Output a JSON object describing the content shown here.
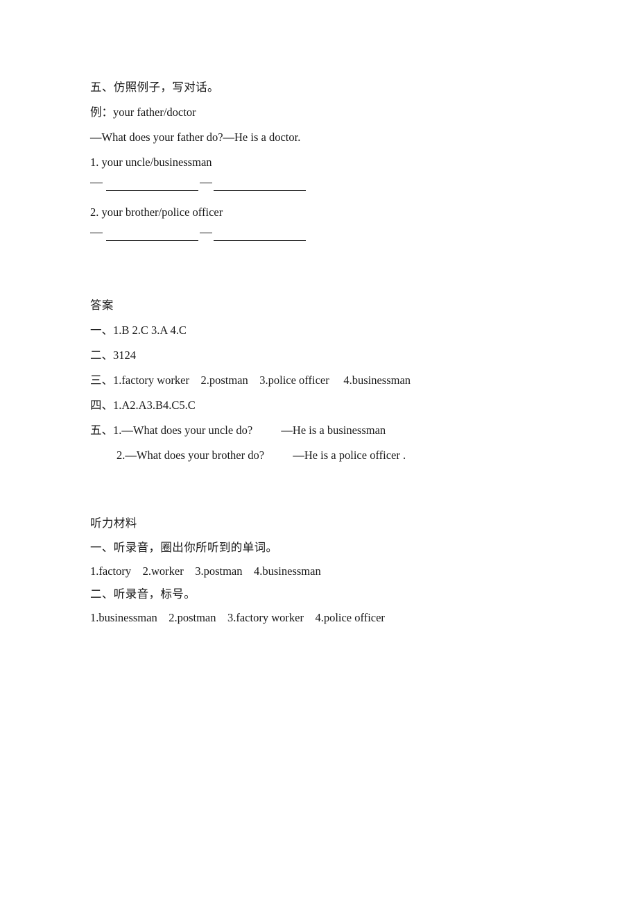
{
  "document": {
    "exercise_section": {
      "title": "五、仿照例子，写对话。",
      "example_label": "例：your father/doctor",
      "example_dialogue": "—What does your father do?—He is a doctor.",
      "items": [
        {
          "prompt": "1. your uncle/businessman"
        },
        {
          "prompt": "2. your brother/police officer"
        }
      ]
    },
    "answers_section": {
      "title": "答案",
      "rows": [
        "一、1.B 2.C 3.A 4.C",
        "二、3124",
        "三、1.factory worker    2.postman    3.police officer     4.businessman",
        "四、1.A2.A3.B4.C5.C"
      ],
      "row_five_label": "五、1.—What does your uncle do?          —He is a businessman",
      "row_five_second": "2.—What does your brother do?          —He is a police officer ."
    },
    "listening_section": {
      "title": "听力材料",
      "part_one_title": "一、听录音，圈出你所听到的单词。",
      "part_one_words": "1.factory    2.worker    3.postman    4.businessman",
      "part_two_title": "二、听录音，标号。",
      "part_two_words": "1.businessman    2.postman    3.factory worker    4.police officer"
    }
  }
}
